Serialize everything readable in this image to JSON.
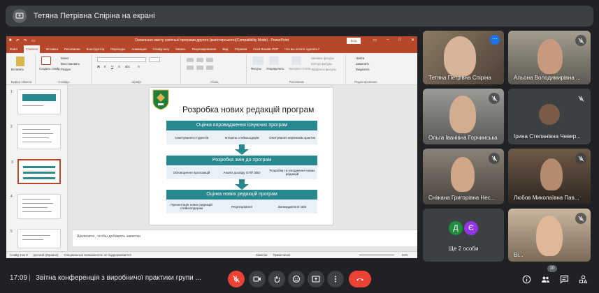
{
  "presenter_banner": {
    "text": "Тетяна Петрівна Спіріна на екрані"
  },
  "powerpoint": {
    "doc_title": "Оновлення змісту освітньої програми другого (магістерського)(Compatibility Mode) - PowerPoint",
    "signin": "Вхід",
    "menu": [
      "Файл",
      "Главная",
      "Вставка",
      "Рисование",
      "Конструктор",
      "Переходы",
      "Анимация",
      "Слайд-шоу",
      "Запись",
      "Рецензирование",
      "Вид",
      "Справка",
      "Foxit Reader PDF",
      "Что вы хотите сделать?"
    ],
    "ribbon": {
      "paste": "Вставить",
      "create_slide": "Создать слайд",
      "layout": "Макет",
      "restore": "Восстановить",
      "section": "Раздел",
      "clipboard": "Буфер обмена",
      "slides": "Слайды",
      "font": "Шрифт",
      "paragraph": "Абзац",
      "shapes": "Фигуры",
      "arrange": "Упорядочить",
      "quick_styles": "Экспресс-стили",
      "fill": "Заливка фигуры",
      "outline": "Контур фигуры",
      "effects": "Эффекты фигуры",
      "drawing": "Рисование",
      "find": "Найти",
      "replace": "Заменить",
      "select": "Выделить",
      "editing": "Редактирование"
    },
    "slide": {
      "title": "Розробка нових редакцій програм",
      "section1": "Оцінка впровадження існуючих програм",
      "section1_items": [
        "Анкетування студентів",
        "Інтерв'ю стейкхолдерів",
        "Опитування керівників практик"
      ],
      "section2": "Розробка змін до програм",
      "section2_items": [
        "Обговорення пропозицій",
        "Аналіз досвіду ОПП ЗВО",
        "Розробка та узгодження нових редакцій"
      ],
      "section3": "Оцінка нових редакцій програм",
      "section3_items": [
        "Презентація нових редакцій стейкхолдерам",
        "Рецензування",
        "Затвердження змін"
      ]
    },
    "thumb_numbers": [
      "1",
      "2",
      "3",
      "4",
      "5"
    ],
    "notes_placeholder": "Щелкните, чтобы добавить заметки",
    "status": {
      "slide": "Слайд 3 из 9",
      "lang": "русский (Украина)",
      "accessibility": "Специальные возможности: не поддерживается",
      "notes": "Заметки",
      "comments": "Примечания",
      "zoom": "64%"
    }
  },
  "participants": [
    {
      "name": "Тетяна Петрівна Спіріна"
    },
    {
      "name": "Альона Володимирівна ..."
    },
    {
      "name": "Ольга Іванівна Горчинська"
    },
    {
      "name": "Ірина Степанівна Чевер..."
    },
    {
      "name": "Сніжана Григорівна Нес..."
    },
    {
      "name": "Любов Миколаївна Пав..."
    },
    {
      "name": "Ще 2 особи",
      "initials": [
        "Д",
        "Є"
      ]
    },
    {
      "name": "Ві..."
    }
  ],
  "bottom_bar": {
    "time": "17:09",
    "separator": "|",
    "meeting": "Звітна конференція з виробничої практики групи ...",
    "participant_count": "10"
  },
  "colors": {
    "accent": "#8ab4f8",
    "end_call": "#ea4335",
    "ppt_brand": "#b7472a",
    "slide_teal": "#27898f"
  }
}
